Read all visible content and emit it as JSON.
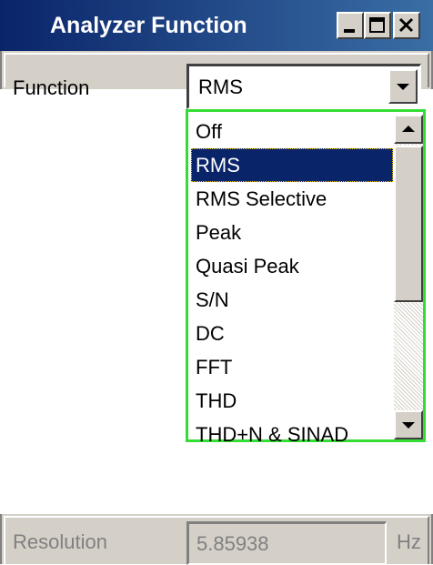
{
  "window": {
    "title": "Analyzer Function",
    "controls": [
      "minimize-icon",
      "maximize-icon",
      "close-icon"
    ]
  },
  "function_row": {
    "label": "Function",
    "selected_value": "RMS"
  },
  "dropdown": {
    "options": [
      "Off",
      "RMS",
      "RMS Selective",
      "Peak",
      "Quasi Peak",
      "S/N",
      "DC",
      "FFT",
      "THD",
      "THD+N & SINAD"
    ],
    "selected_index": 1,
    "focus_border_color": "#33dd33"
  },
  "resolution_row": {
    "label": "Resolution",
    "value": "5.85938",
    "unit": "Hz",
    "enabled": false
  },
  "colors": {
    "titlebar_start": "#0a246a",
    "titlebar_end": "#3a6ea5",
    "selection": "#0a246a",
    "face": "#d4d0c8"
  }
}
